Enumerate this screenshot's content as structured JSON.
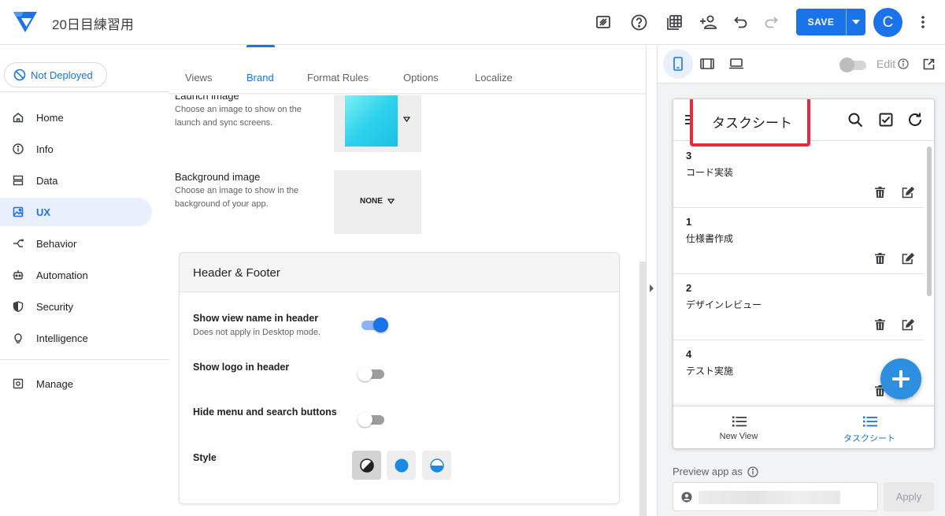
{
  "app": {
    "title": "20日目練習用"
  },
  "toolbar": {
    "icons": [
      "frame-icon",
      "help-icon",
      "table-icon",
      "add-user-icon",
      "undo-icon",
      "redo-icon"
    ],
    "save_label": "SAVE",
    "avatar_letter": "C",
    "brand_color": "#1a73e8"
  },
  "sidebar": {
    "deploy_status": "Not Deployed",
    "items": [
      {
        "label": "Home",
        "icon": "home-icon"
      },
      {
        "label": "Info",
        "icon": "info-icon"
      },
      {
        "label": "Data",
        "icon": "data-icon"
      },
      {
        "label": "UX",
        "icon": "ux-icon",
        "active": true
      },
      {
        "label": "Behavior",
        "icon": "behavior-icon"
      },
      {
        "label": "Automation",
        "icon": "automation-icon"
      },
      {
        "label": "Security",
        "icon": "security-icon"
      },
      {
        "label": "Intelligence",
        "icon": "intelligence-icon"
      },
      {
        "label": "Manage",
        "icon": "manage-icon"
      }
    ]
  },
  "tabs": [
    {
      "label": "Views"
    },
    {
      "label": "Brand",
      "active": true
    },
    {
      "label": "Format Rules"
    },
    {
      "label": "Options"
    },
    {
      "label": "Localize"
    }
  ],
  "brand": {
    "launch_image": {
      "title": "Launch image",
      "desc": "Choose an image to show on the launch and sync screens."
    },
    "background_image": {
      "title": "Background image",
      "desc": "Choose an image to show in the background of your app.",
      "value": "NONE"
    }
  },
  "header_footer": {
    "title": "Header & Footer",
    "rows": [
      {
        "label": "Show view name in header",
        "sub": "Does not apply in Desktop mode.",
        "on": true
      },
      {
        "label": "Show logo in header",
        "on": false
      },
      {
        "label": "Hide menu and search buttons",
        "on": false
      }
    ],
    "style_label": "Style",
    "style_options": [
      "contrast-icon",
      "solid-circle-icon",
      "half-circle-icon"
    ],
    "style_selected": 0
  },
  "preview": {
    "edit_label": "Edit",
    "view_title": "タスクシート",
    "items": [
      {
        "num": "3",
        "name": "コード実装"
      },
      {
        "num": "1",
        "name": "仕様書作成"
      },
      {
        "num": "2",
        "name": "デザインレビュー"
      },
      {
        "num": "4",
        "name": "テスト実施"
      }
    ],
    "nav": [
      {
        "label": "New View"
      },
      {
        "label": "タスクシート",
        "active": true
      }
    ],
    "preview_as_label": "Preview app as",
    "apply_label": "Apply",
    "highlight_color": "#ea2a3a"
  }
}
